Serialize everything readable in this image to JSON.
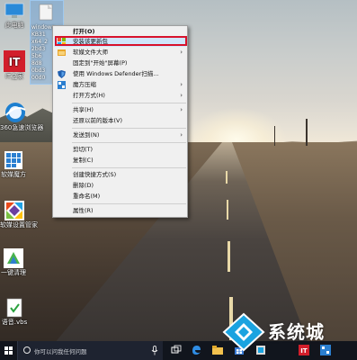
{
  "desktop": {
    "icons": [
      {
        "label": "此电脑"
      },
      {
        "label": "IT之家"
      },
      {
        "label": "360急速浏览器"
      },
      {
        "label": "软媒魔方"
      },
      {
        "label": "软媒设置管家"
      },
      {
        "label": "一键清理"
      },
      {
        "label": "语音.vbs"
      }
    ],
    "selected_file_labels": [
      "windows",
      "KB31",
      "x64_2",
      "2bd3",
      "5b6",
      "8d8",
      "0bd3",
      "00d0"
    ]
  },
  "context_menu": {
    "items": [
      {
        "label": "打开(O)",
        "icon": "none",
        "arrow": false
      },
      {
        "label": "安装该更新包",
        "icon": "shield-icon",
        "arrow": false,
        "highlighted": true
      },
      {
        "label": "软媒文件大师",
        "icon": "folder-master-icon",
        "arrow": true
      },
      {
        "label": "固定到\"开始\"屏幕(P)",
        "icon": "none",
        "arrow": false
      },
      {
        "label": "使用 Windows Defender扫描...",
        "icon": "defender-icon",
        "arrow": false
      },
      {
        "label": "魔方压缩",
        "icon": "cube-icon",
        "arrow": true
      },
      {
        "label": "打开方式(H)",
        "icon": "none",
        "arrow": true
      },
      {
        "label": "共享(H)",
        "icon": "none",
        "arrow": true
      },
      {
        "label": "还原以前的版本(V)",
        "icon": "none",
        "arrow": false
      },
      {
        "label": "发送到(N)",
        "icon": "none",
        "arrow": true
      },
      {
        "label": "剪切(T)",
        "icon": "none",
        "arrow": false
      },
      {
        "label": "复制(C)",
        "icon": "none",
        "arrow": false
      },
      {
        "label": "创建快捷方式(S)",
        "icon": "none",
        "arrow": false
      },
      {
        "label": "删除(D)",
        "icon": "none",
        "arrow": false
      },
      {
        "label": "重命名(M)",
        "icon": "none",
        "arrow": false
      },
      {
        "label": "属性(R)",
        "icon": "none",
        "arrow": false
      }
    ]
  },
  "taskbar": {
    "search_placeholder": "你可以问我任何问题"
  },
  "watermark": {
    "text": "系统城"
  },
  "colors": {
    "highlight_border": "#d8122c",
    "taskbar": "#10141c",
    "watermark_blue": "#1aa3e0"
  }
}
